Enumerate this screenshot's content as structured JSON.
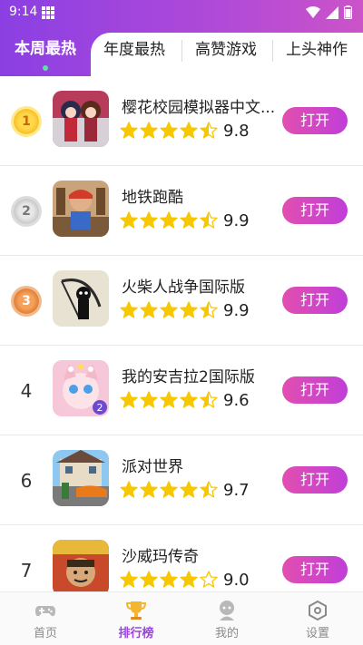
{
  "status_bar": {
    "time": "9:14"
  },
  "tabs": [
    {
      "label": "本周最热",
      "active": true
    },
    {
      "label": "年度最热",
      "active": false
    },
    {
      "label": "高赞游戏",
      "active": false
    },
    {
      "label": "上头神作",
      "active": false
    }
  ],
  "apps": [
    {
      "rank": "1",
      "medal": "gold",
      "name": "樱花校园模拟器中文...",
      "rating": 4.5,
      "score": "9.8",
      "button": "打开"
    },
    {
      "rank": "2",
      "medal": "silver",
      "name": "地铁跑酷",
      "rating": 4.5,
      "score": "9.9",
      "button": "打开"
    },
    {
      "rank": "3",
      "medal": "bronze",
      "name": "火柴人战争国际版",
      "rating": 4.5,
      "score": "9.9",
      "button": "打开"
    },
    {
      "rank": "4",
      "medal": "",
      "name": "我的安吉拉2国际版",
      "rating": 4.5,
      "score": "9.6",
      "button": "打开"
    },
    {
      "rank": "6",
      "medal": "",
      "name": "派对世界",
      "rating": 4.5,
      "score": "9.7",
      "button": "打开"
    },
    {
      "rank": "7",
      "medal": "",
      "name": "沙威玛传奇",
      "rating": 4.0,
      "score": "9.0",
      "button": "打开"
    }
  ],
  "bottom_nav": [
    {
      "label": "首页",
      "icon": "gamepad-icon",
      "active": false
    },
    {
      "label": "排行榜",
      "icon": "trophy-icon",
      "active": true
    },
    {
      "label": "我的",
      "icon": "user-icon",
      "active": false
    },
    {
      "label": "设置",
      "icon": "settings-hexagon-icon",
      "active": false
    }
  ],
  "colors": {
    "accent": "#9b43e0",
    "button": "#d545c4",
    "star": "#f7c700"
  }
}
